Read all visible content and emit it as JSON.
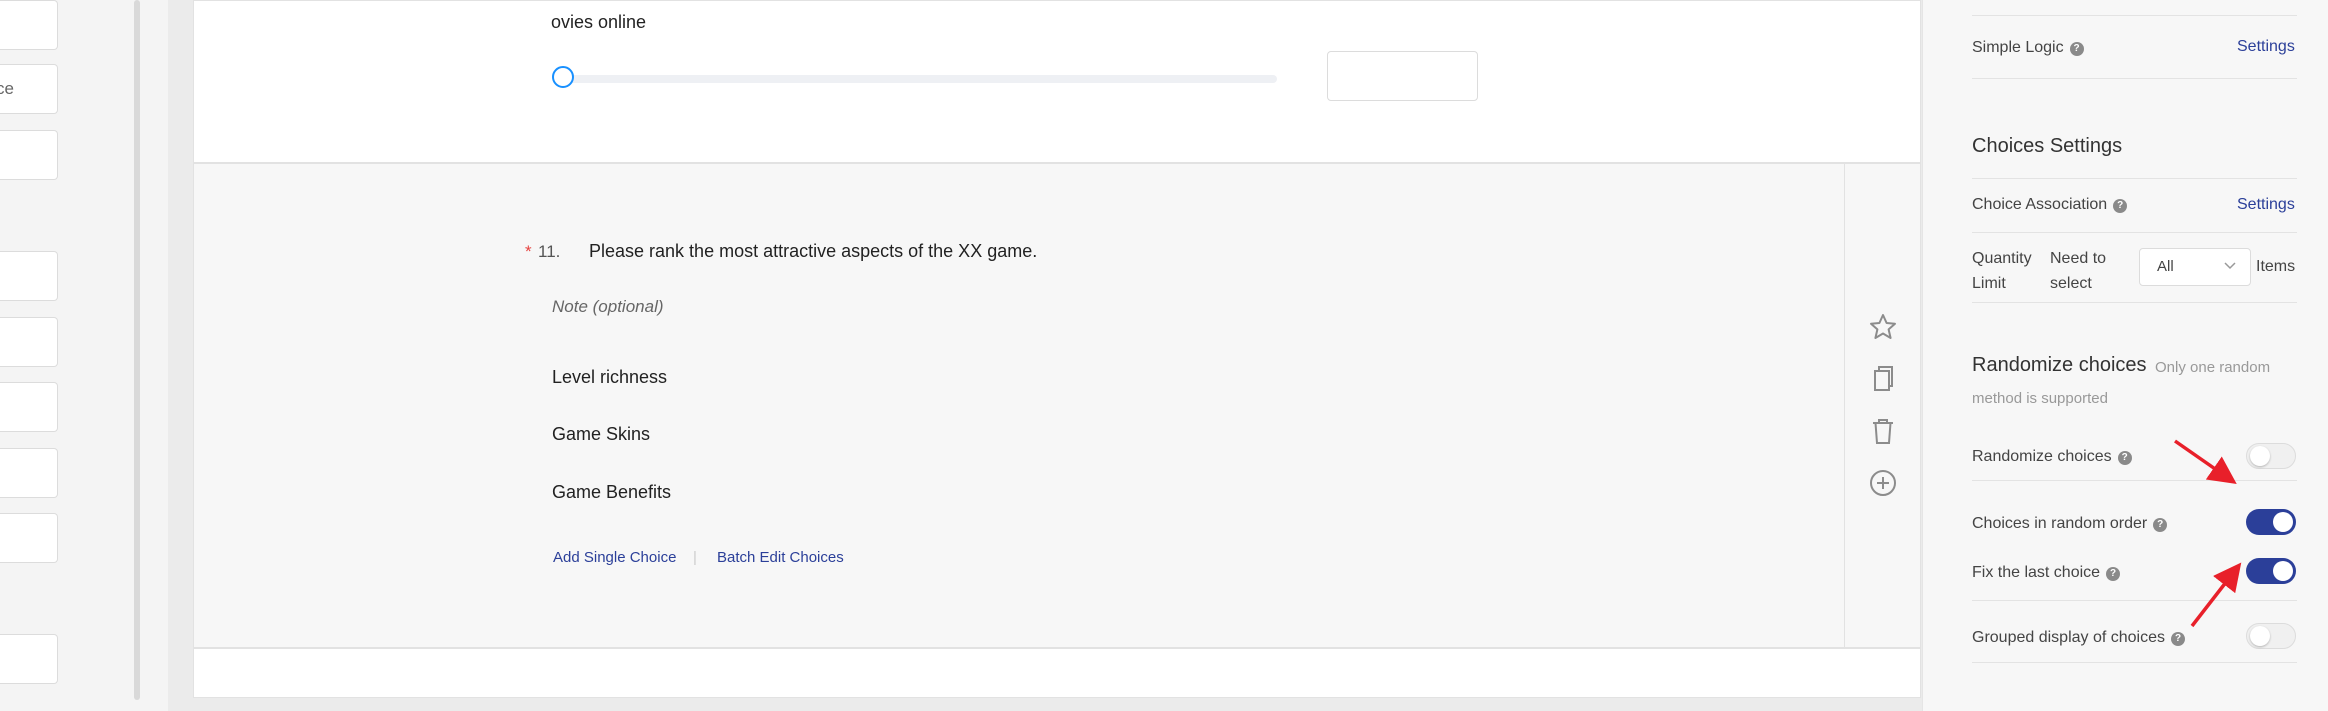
{
  "left_panel": {
    "inputs": [
      "",
      "ce",
      "",
      "",
      "",
      "",
      "",
      "",
      ""
    ]
  },
  "question10": {
    "title_partial": "ovies online"
  },
  "question11": {
    "required_mark": "*",
    "number": "11.",
    "title": "Please rank the most attractive aspects of the XX game.",
    "note_placeholder": "Note (optional)",
    "choices": [
      "Level richness",
      "Game Skins",
      "Game Benefits"
    ],
    "add_single_choice": "Add Single Choice",
    "separator": "|",
    "batch_edit_choices": "Batch Edit Choices",
    "toolbar_icons": [
      "star-icon",
      "copy-icon",
      "trash-icon",
      "add-circle-icon"
    ]
  },
  "settings": {
    "simple_logic_label": "Simple Logic",
    "simple_logic_link": "Settings",
    "choices_settings_title": "Choices Settings",
    "choice_association_label": "Choice Association",
    "choice_association_link": "Settings",
    "quantity_limit_label_line1": "Quantity",
    "quantity_limit_label_line2": "Limit",
    "need_to_select_line1": "Need to",
    "need_to_select_line2": "select",
    "quantity_select_value": "All",
    "items_label": "Items",
    "randomize_title": "Randomize choices",
    "randomize_hint_line1": "Only one random",
    "randomize_hint_line2": "method is supported",
    "toggles": [
      {
        "label": "Randomize choices",
        "on": false
      },
      {
        "label": "Choices in random order",
        "on": true
      },
      {
        "label": "Fix the last choice",
        "on": true
      },
      {
        "label": "Grouped display of choices",
        "on": false
      }
    ]
  },
  "colors": {
    "accent": "#2b3f99",
    "slider_handle": "#1890ff",
    "annotation_arrow": "#e8202a",
    "required": "#e64340"
  }
}
